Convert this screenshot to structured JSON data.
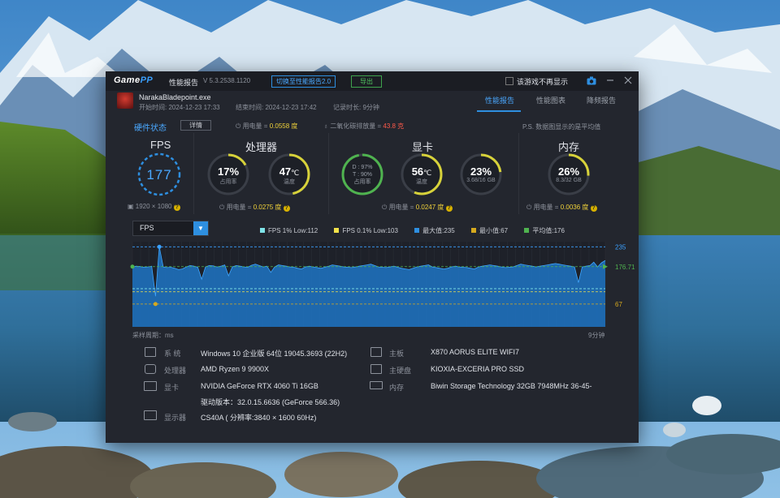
{
  "app": {
    "logo_a": "Game",
    "logo_b": "PP",
    "window_title": "性能报告",
    "version": "V 5.3.2538.1120",
    "switch_button": "切换至性能报告2.0",
    "export_button": "导出",
    "no_show_checkbox": "该游戏不再显示"
  },
  "game": {
    "exe": "NarakaBladepoint.exe",
    "start": "开始时间: 2024-12-23 17:33",
    "end": "结束时间: 2024-12-23 17:42",
    "duration": "记录时长: 9分钟"
  },
  "tabs": [
    "性能报告",
    "性能图表",
    "降频报告"
  ],
  "status": {
    "label": "硬件状态",
    "detail_button": "详情",
    "total_power_label": "用电量 =",
    "total_power_value": "0.0558 度",
    "co2_label": "二氧化碳排放量 =",
    "co2_value": "43.8 克",
    "note": "P.S. 数据图显示的是平均值"
  },
  "fps_card": {
    "title": "FPS",
    "value": "177",
    "resolution": "1920 × 1080"
  },
  "cpu_card": {
    "title": "处理器",
    "usage_value": "17%",
    "usage_label": "占用率",
    "usage_fraction": 0.17,
    "temp_value": "47",
    "temp_unit": "℃",
    "temp_label": "温度",
    "temp_fraction": 0.47,
    "power_label": "用电量 =",
    "power_value": "0.0275 度"
  },
  "gpu_card": {
    "title": "显卡",
    "dt_d": "D : 97%",
    "dt_t": "T : 90%",
    "dt_label": "占用率",
    "dt_fraction": 0.97,
    "temp_value": "56",
    "temp_unit": "℃",
    "temp_label": "温度",
    "temp_fraction": 0.56,
    "vram_value": "23%",
    "vram_sub": "3.68/16 GB",
    "vram_fraction": 0.23,
    "power_label": "用电量 =",
    "power_value": "0.0247 度"
  },
  "mem_card": {
    "title": "内存",
    "value": "26%",
    "sub": "8.3/32 GB",
    "fraction": 0.26,
    "power_label": "用电量 =",
    "power_value": "0.0036 度"
  },
  "chart_controls": {
    "metric_select": "FPS",
    "legend": [
      {
        "label": "FPS 1% Low:112",
        "color": "#7fe3e8"
      },
      {
        "label": "FPS 0.1% Low:103",
        "color": "#f2e14a"
      },
      {
        "label": "最大值:235",
        "color": "#2e8fe0"
      },
      {
        "label": "最小值:67",
        "color": "#d6a91e"
      },
      {
        "label": "平均值:176",
        "color": "#4fb34f"
      }
    ],
    "x_left_label": "采样周期：ms",
    "x_right_label": "9分钟"
  },
  "chart_data": {
    "type": "area",
    "title": "",
    "xlabel": "采样周期：ms",
    "ylabel": "",
    "x_range_label": [
      "",
      "9分钟"
    ],
    "ylim": [
      0,
      250
    ],
    "reference_lines": [
      {
        "name": "最大值",
        "value": 235,
        "label": "235",
        "color": "#3aa0ff"
      },
      {
        "name": "平均值",
        "value": 176.71,
        "label": "176.71",
        "color": "#4fb34f"
      },
      {
        "name": "最小值",
        "value": 67,
        "label": "67",
        "color": "#d6a91e"
      },
      {
        "name": "FPS 1% Low",
        "value": 112,
        "color": "#7fe3e8"
      },
      {
        "name": "FPS 0.1% Low",
        "value": 103,
        "color": "#f2e14a"
      }
    ],
    "series": [
      {
        "name": "FPS",
        "values": [
          176,
          178,
          177,
          175,
          176,
          178,
          90,
          235,
          176,
          174,
          175,
          172,
          168,
          170,
          176,
          180,
          178,
          175,
          140,
          176,
          180,
          179,
          176,
          178,
          182,
          150,
          176,
          180,
          178,
          176,
          175,
          181,
          184,
          180,
          176,
          178,
          160,
          176,
          182,
          180,
          178,
          176,
          175,
          172,
          170,
          176,
          178,
          176,
          174,
          172,
          175,
          178,
          182,
          180,
          178,
          176,
          175,
          174,
          176,
          178,
          180,
          182,
          184,
          180,
          176,
          175,
          174,
          176,
          178,
          175,
          172,
          170,
          168,
          172,
          176,
          178,
          180,
          182,
          176,
          174,
          172,
          170,
          172,
          176,
          178,
          176,
          175,
          174,
          172,
          170,
          176,
          178,
          180,
          182,
          180,
          178,
          176,
          174,
          175,
          176,
          180,
          184,
          182,
          180,
          178,
          176,
          178,
          180,
          182,
          184,
          186,
          184,
          182,
          180,
          178,
          176,
          130,
          176,
          178,
          180,
          190,
          176,
          188,
          195
        ]
      }
    ]
  },
  "sysinfo": {
    "os_label": "系 统",
    "os_value": "Windows 10 企业版 64位 19045.3693 (22H2)",
    "cpu_label": "处理器",
    "cpu_value": "AMD Ryzen 9 9900X",
    "gpu_label": "显卡",
    "gpu_value": "NVIDIA GeForce RTX 4060 Ti 16GB",
    "driver_value": "驱动版本：32.0.15.6636 (GeForce 566.36)",
    "display_label": "显示器",
    "display_value": "CS40A ( 分辨率:3840 × 1600 60Hz)",
    "board_label": "主板",
    "board_value": "X870 AORUS ELITE WIFI7",
    "disk_label": "主硬盘",
    "disk_value": "KIOXIA-EXCERIA PRO SSD",
    "mem_label": "内存",
    "mem_value": "Biwin Storage Technology 32GB 7948MHz 36-45-"
  }
}
